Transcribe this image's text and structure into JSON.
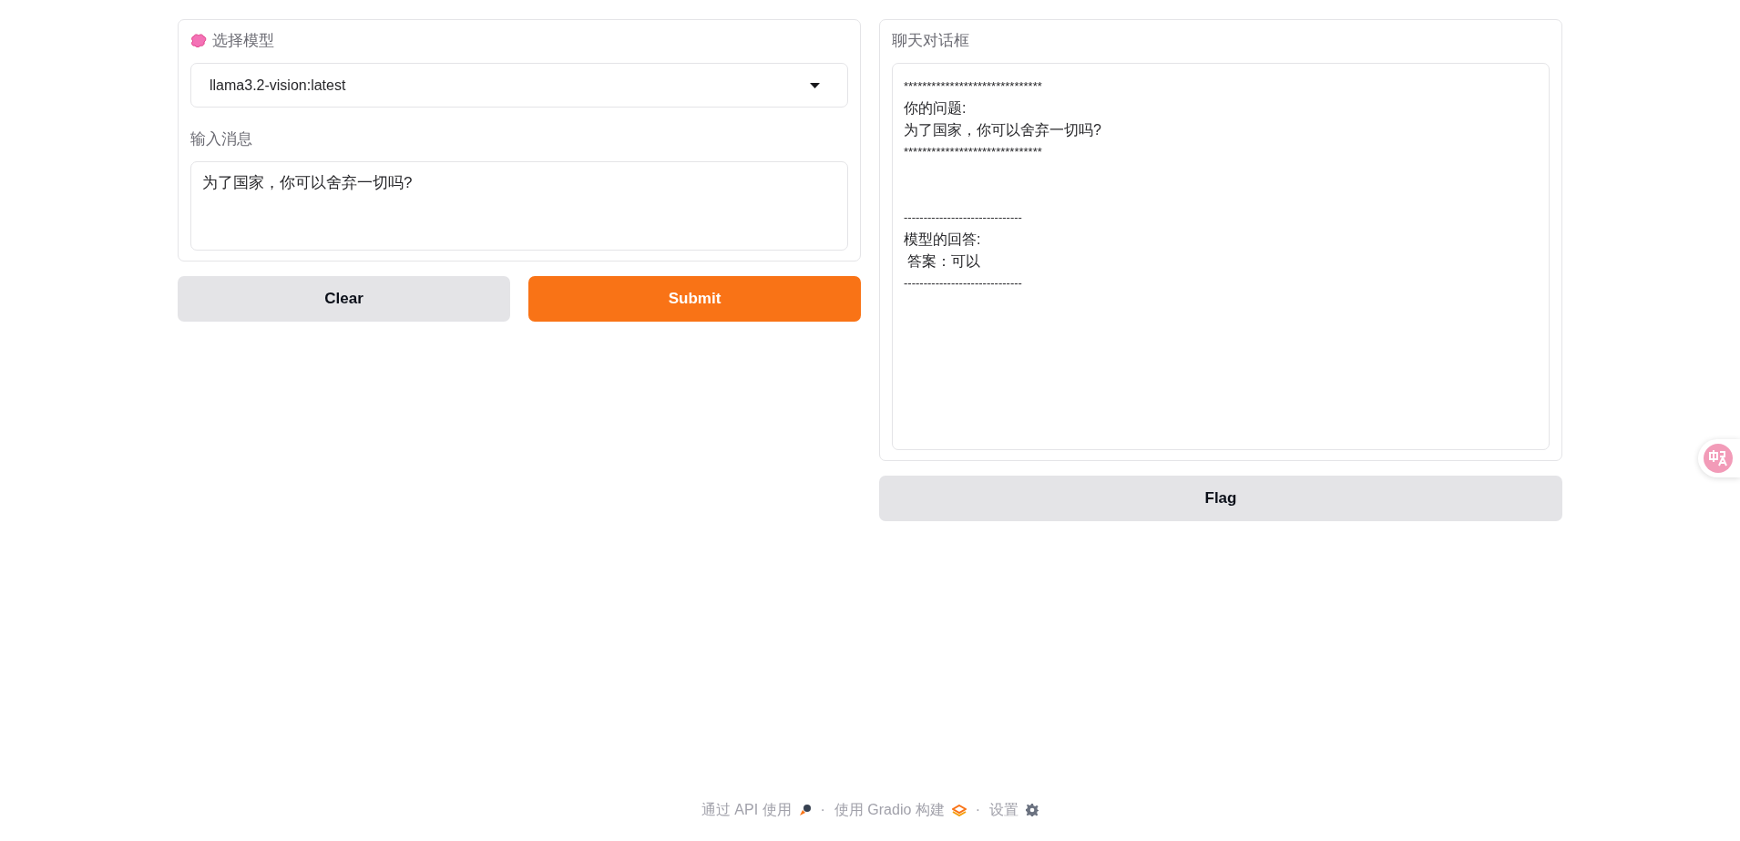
{
  "model_selector": {
    "label": "选择模型",
    "value": "llama3.2-vision:latest"
  },
  "message_input": {
    "label": "输入消息",
    "value": "为了国家，你可以舍弃一切吗?"
  },
  "buttons": [
    {
      "label": "Clear",
      "kind": "secondary"
    },
    {
      "label": "Submit",
      "kind": "primary"
    }
  ],
  "chat": {
    "label": "聊天对话框",
    "blocks": [
      {
        "lines": [
          "******************************",
          "你的问题:",
          "为了国家，你可以舍弃一切吗?",
          "******************************"
        ]
      },
      {
        "lines": [
          "------------------------------",
          "模型的回答:",
          " 答案：可以",
          "------------------------------"
        ]
      }
    ]
  },
  "flag_button": {
    "label": "Flag",
    "kind": "secondary"
  },
  "footer": [
    {
      "label": "通过 API 使用",
      "kind": "api"
    },
    {
      "label": "·",
      "kind": "separator"
    },
    {
      "label": "使用 Gradio 构建",
      "kind": "gradio"
    },
    {
      "label": "·",
      "kind": "separator"
    },
    {
      "label": "设置",
      "kind": "settings"
    }
  ]
}
